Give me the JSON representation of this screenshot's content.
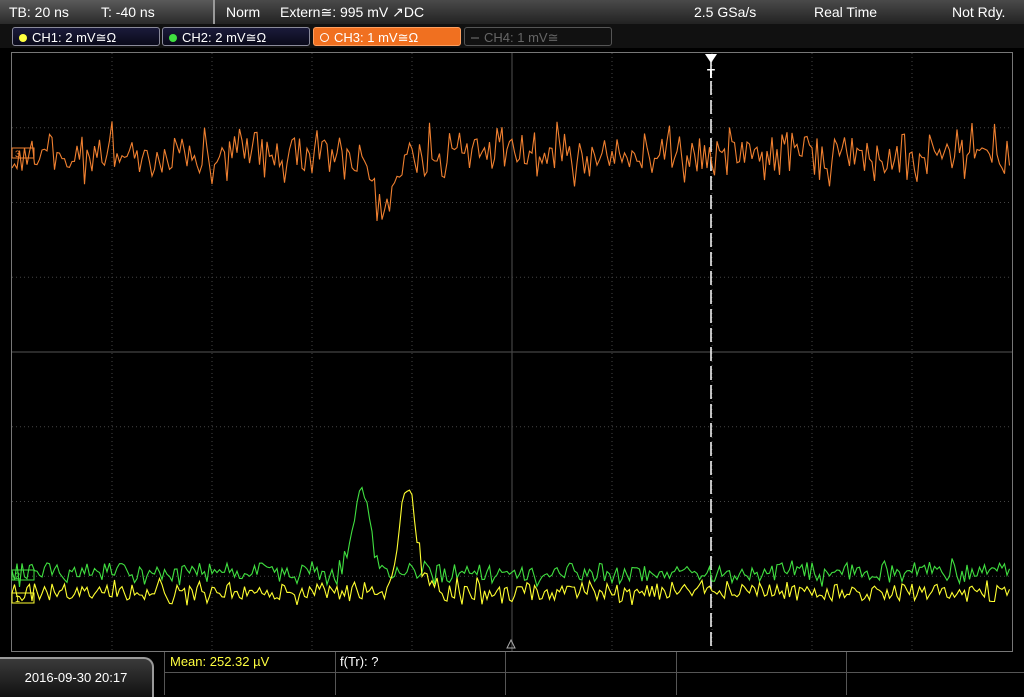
{
  "topbar": {
    "timebase": "TB: 20 ns",
    "trigger_pos": "T: -40 ns",
    "mode": "Norm",
    "trigger_source": "Extern≅: 995 mV ↗DC",
    "sample_rate": "2.5 GSa/s",
    "acq_mode": "Real Time",
    "status": "Not Rdy."
  },
  "channels": [
    {
      "label": "CH1: 2 mV≅Ω",
      "color": "#ffff40"
    },
    {
      "label": "CH2: 2 mV≅Ω",
      "color": "#40e040"
    },
    {
      "label": "CH3: 1 mV≅Ω",
      "color": "#f07020"
    },
    {
      "label": "CH4: 1 mV≅",
      "color": "#555555"
    }
  ],
  "trigger_marker": "T",
  "markers": {
    "ch3": "3",
    "ch2": "2",
    "ch1": "1"
  },
  "bottom": {
    "datetime": "2016-09-30 20:17",
    "mean": "Mean: 252.32 µV",
    "freq": "f(Tr): ?"
  }
}
